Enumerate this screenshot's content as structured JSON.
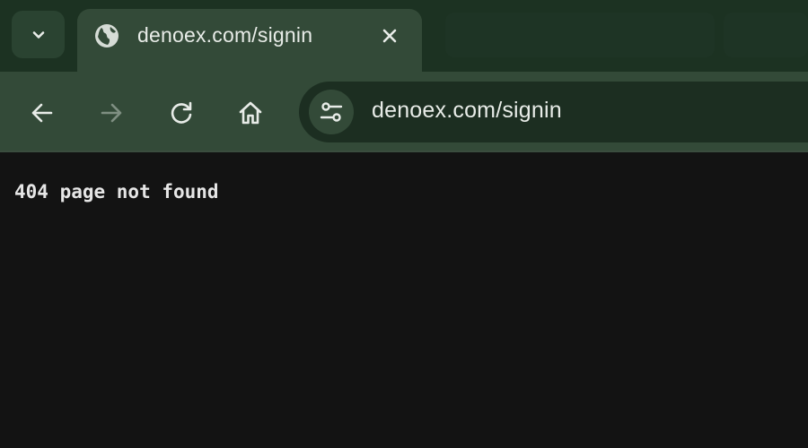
{
  "tab": {
    "title": "denoex.com/signin",
    "favicon": "globe-icon"
  },
  "toolbar": {
    "back_icon": "arrow-left-icon",
    "forward_icon": "arrow-right-icon",
    "reload_icon": "reload-icon",
    "home_icon": "home-icon",
    "site_info_icon": "tune-icon"
  },
  "omnibox": {
    "url": "denoex.com/signin"
  },
  "page": {
    "message": "404 page not found"
  },
  "colors": {
    "frame": "#1c3222",
    "toolbar": "#334a38",
    "omnibox": "#1c2e21",
    "page_background": "#131313",
    "text": "#e8ece8",
    "disabled_icon": "#7f8f82"
  }
}
